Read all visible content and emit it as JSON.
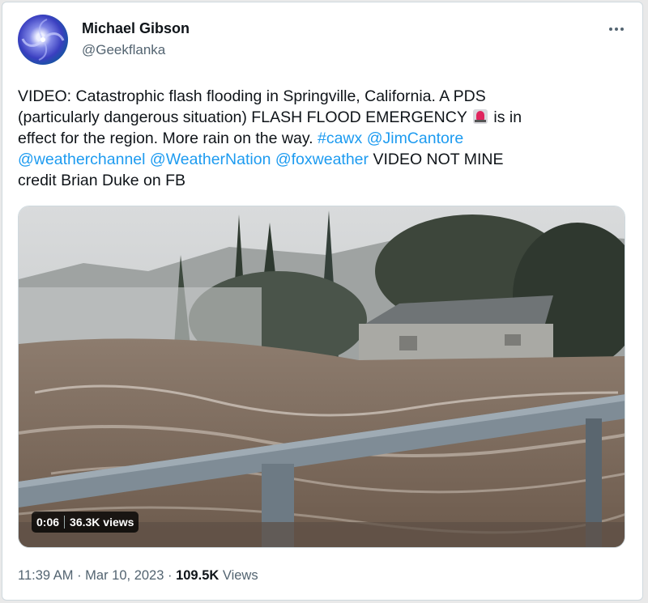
{
  "author": {
    "name": "Michael Gibson",
    "handle": "@Geekflanka"
  },
  "tweet": {
    "line1": "VIDEO: Catastrophic flash flooding in Springville, California. A PDS",
    "line2": "(particularly dangerous situation) FLASH FLOOD EMERGENCY",
    "line2_tail": " is in",
    "line3": "effect for the region. More rain on the way. ",
    "hashtag": "#cawx",
    "mention1": "@JimCantore",
    "mention2": "@weatherchannel",
    "mention3": "@WeatherNation",
    "mention4": "@foxweather",
    "tail": " VIDEO NOT MINE",
    "line5": "credit Brian Duke on FB",
    "emoji": "rotating-light-icon"
  },
  "video": {
    "duration": "0:06",
    "views": "36.3K views"
  },
  "meta": {
    "time": "11:39 AM",
    "dot1": " · ",
    "date": "Mar 10, 2023",
    "dot2": " · ",
    "view_count": "109.5K",
    "views_label": " Views"
  },
  "colors": {
    "link": "#1d9bf0",
    "muted": "#536471",
    "text": "#0f1419"
  }
}
